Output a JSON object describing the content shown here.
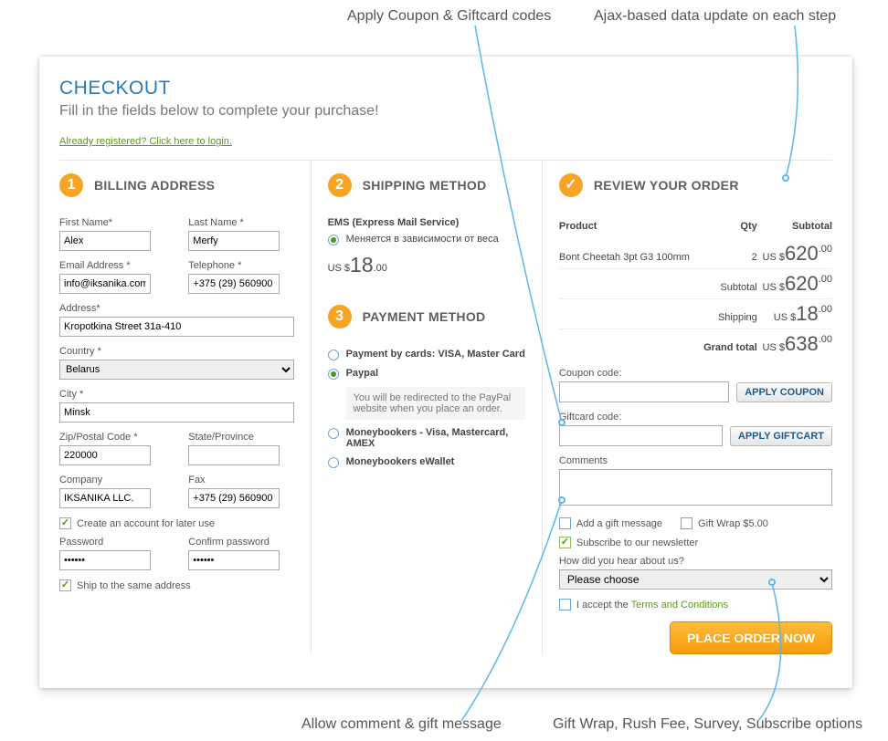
{
  "annotations": {
    "top_left": "Apply Coupon & Giftcard codes",
    "top_right": "Ajax-based data update on each step",
    "bottom_left": "Allow comment & gift message",
    "bottom_right": "Gift Wrap, Rush Fee, Survey, Subscribe options"
  },
  "header": {
    "title": "CHECKOUT",
    "subtitle": "Fill in the fields below to complete your purchase!",
    "login_link": "Already registered? Click here to login."
  },
  "billing": {
    "badge": "1",
    "title": "BILLING ADDRESS",
    "labels": {
      "first_name": "First Name*",
      "last_name": "Last Name *",
      "email": "Email Address *",
      "telephone": "Telephone *",
      "address": "Address*",
      "country": "Country *",
      "city": "City *",
      "zip": "Zip/Postal Code *",
      "state": "State/Province",
      "company": "Company",
      "fax": "Fax",
      "create_account": "Create an account for later use",
      "password": "Password",
      "confirm": "Confirm password",
      "ship_same": "Ship to the same address"
    },
    "values": {
      "first_name": "Alex",
      "last_name": "Merfy",
      "email": "info@iksanika.com",
      "telephone": "+375 (29) 560900",
      "address": "Kropotkina Street 31a-410",
      "country": "Belarus",
      "city": "Minsk",
      "zip": "220000",
      "state": "",
      "company": "IKSANIKA LLC.",
      "fax": "+375 (29) 560900",
      "password": "••••••",
      "confirm": "••••••"
    }
  },
  "shipping": {
    "badge": "2",
    "title": "SHIPPING METHOD",
    "method_name": "EMS (Express Mail Service)",
    "method_note": "Меняется в зависимости от веса",
    "price_currency": "US $",
    "price_int": "18",
    "price_dec": ".00"
  },
  "payment": {
    "badge": "3",
    "title": "PAYMENT METHOD",
    "options": {
      "cards": "Payment by cards: VISA, Master Card",
      "paypal": "Paypal",
      "paypal_note": "You will be redirected to the PayPal website when you place an order.",
      "mb_cards": "Moneybookers - Visa, Mastercard, AMEX",
      "mb_wallet": "Moneybookers eWallet"
    }
  },
  "review": {
    "title": "REVIEW YOUR ORDER",
    "headers": {
      "product": "Product",
      "qty": "Qty",
      "subtotal": "Subtotal"
    },
    "line": {
      "name": "Bont Cheetah 3pt G3 100mm",
      "qty": "2",
      "cur": "US $",
      "int": "620",
      "dec": ".00"
    },
    "subtotal": {
      "label": "Subtotal",
      "cur": "US $",
      "int": "620",
      "dec": ".00"
    },
    "shipping": {
      "label": "Shipping",
      "cur": "US $",
      "int": "18",
      "dec": ".00"
    },
    "grand": {
      "label": "Grand total",
      "cur": "US $",
      "int": "638",
      "dec": ".00"
    },
    "coupon_label": "Coupon code:",
    "coupon_btn": "APPLY COUPON",
    "giftcard_label": "Giftcard code:",
    "giftcard_btn": "APPLY GIFTCART",
    "comments_label": "Comments",
    "gift_msg": "Add a gift message",
    "gift_wrap": "Gift Wrap $5.00",
    "newsletter": "Subscribe to our newsletter",
    "hear_label": "How did you hear about us?",
    "hear_value": "Please choose",
    "accept_prefix": "I accept the ",
    "accept_link": "Terms and Conditions",
    "place_btn": "PLACE ORDER NOW"
  }
}
